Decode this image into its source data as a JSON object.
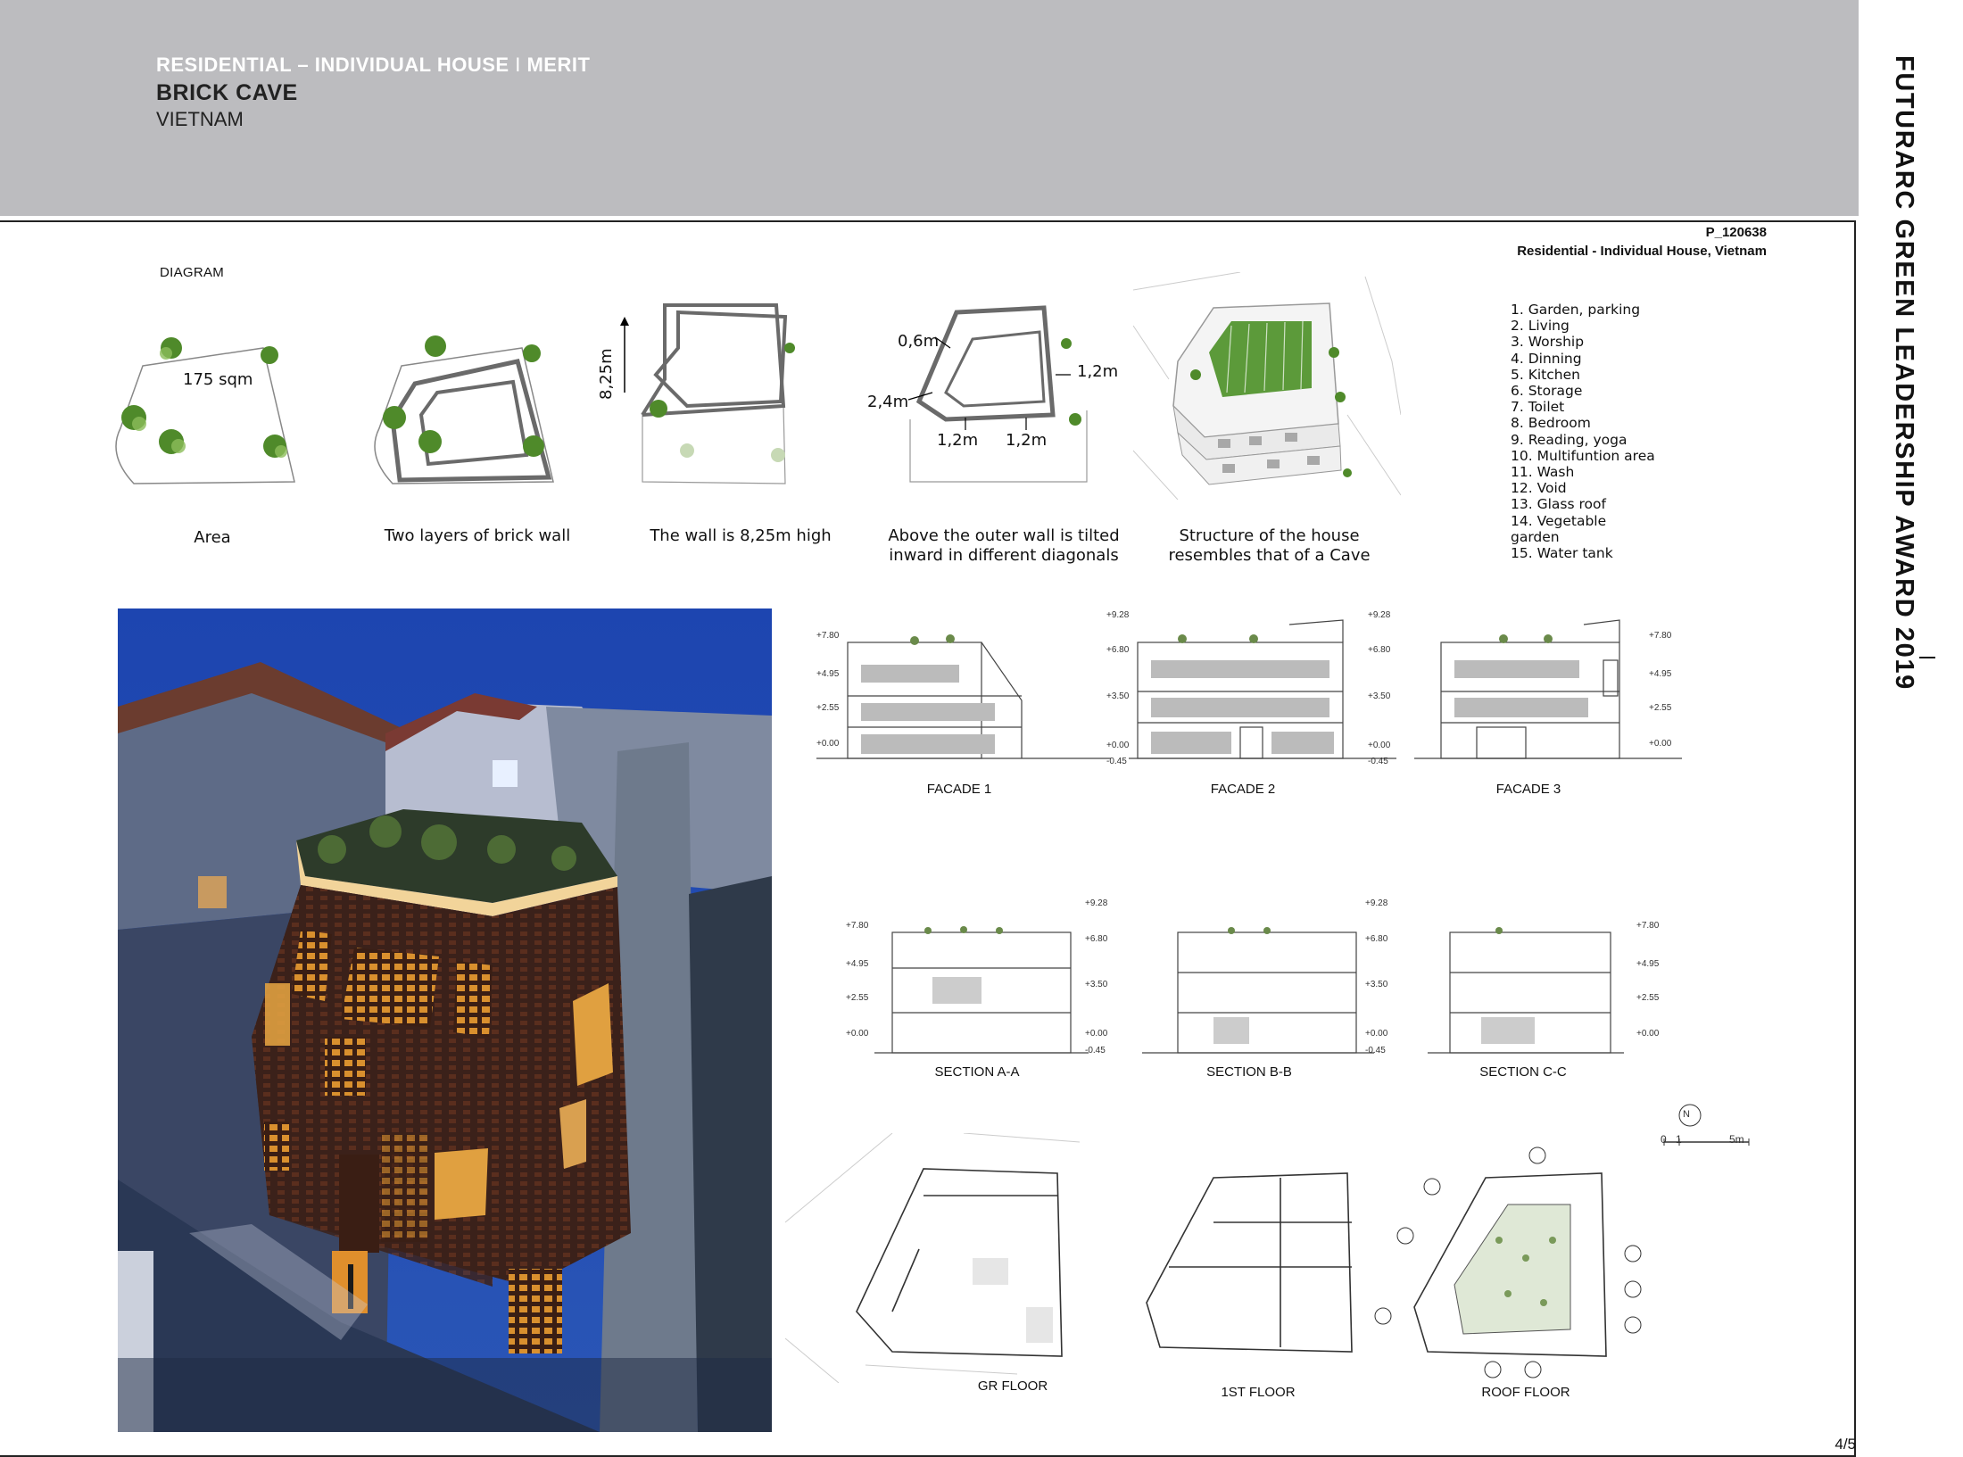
{
  "header": {
    "category": "RESIDENTIAL – INDIVIDUAL HOUSE",
    "separator": "I",
    "award": "MERIT",
    "title": "BRICK CAVE",
    "location": "VIETNAM"
  },
  "side_title": "FUTURARC GREEN LEADERSHIP AWARD 2019",
  "project": {
    "code": "P_120638",
    "subtitle": "Residential - Individual House, Vietnam"
  },
  "diagram": {
    "label": "DIAGRAM",
    "area_value": "175 sqm",
    "height_label": "8,25m",
    "dims": {
      "d06": "0,6m",
      "d12a": "1,2m",
      "d24": "2,4m",
      "d12b": "1,2m",
      "d12c": "1,2m"
    },
    "captions": {
      "area": "Area",
      "layers": "Two layers of brick wall",
      "height": "The wall is 8,25m high",
      "tilt_1": "Above the outer wall is tilted",
      "tilt_2": "inward in different diagonals",
      "cave_1": "Structure of the house",
      "cave_2": "resembles that of a Cave"
    }
  },
  "legend": [
    "1. Garden, parking",
    "2. Living",
    "3. Worship",
    "4. Dinning",
    "5. Kitchen",
    "6. Storage",
    "7. Toilet",
    "8. Bedroom",
    "9. Reading, yoga",
    "10. Multifuntion area",
    "11. Wash",
    "12. Void",
    "13. Glass roof",
    "14. Vegetable",
    "garden",
    "15. Water tank"
  ],
  "drawings": {
    "facade1": "FACADE 1",
    "facade2": "FACADE 2",
    "facade3": "FACADE 3",
    "sectionA": "SECTION A-A",
    "sectionB": "SECTION B-B",
    "sectionC": "SECTION C-C",
    "gr": "GR FLOOR",
    "first": "1ST FLOOR",
    "roof": "ROOF FLOOR"
  },
  "levels": {
    "l928": "+9.28",
    "l680": "+6.80",
    "l350": "+3.50",
    "l000": "+0.00",
    "lneg": "-0.45",
    "l780": "+7.80",
    "l495": "+4.95",
    "l255": "+2.55"
  },
  "scale": {
    "zero": "0",
    "one": "1",
    "five": "5m",
    "north": "N"
  },
  "page_number": "4/5",
  "colors": {
    "header_bg": "#bcbcbf",
    "sky": "#1e4aa8",
    "brick_glow": "#e0a040"
  }
}
